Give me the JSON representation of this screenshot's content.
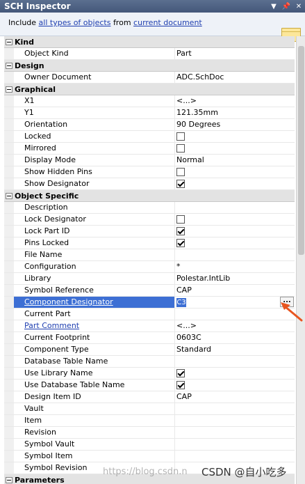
{
  "title": "SCH Inspector",
  "filter": {
    "prefix": "Include",
    "link1": "all types of objects",
    "middle": "from",
    "link2": "current document"
  },
  "categories": {
    "kind": "Kind",
    "design": "Design",
    "graphical": "Graphical",
    "object_specific": "Object Specific",
    "parameters": "Parameters"
  },
  "kind": {
    "object_kind": {
      "name": "Object Kind",
      "value": "Part"
    }
  },
  "design": {
    "owner_document": {
      "name": "Owner Document",
      "value": "ADC.SchDoc"
    }
  },
  "graphical": {
    "x1": {
      "name": "X1",
      "value": "<...>"
    },
    "y1": {
      "name": "Y1",
      "value": "121.35mm"
    },
    "orientation": {
      "name": "Orientation",
      "value": "90 Degrees"
    },
    "locked": {
      "name": "Locked",
      "checked": false
    },
    "mirrored": {
      "name": "Mirrored",
      "checked": false
    },
    "display_mode": {
      "name": "Display Mode",
      "value": "Normal"
    },
    "show_hidden_pins": {
      "name": "Show Hidden Pins",
      "checked": false
    },
    "show_designator": {
      "name": "Show Designator",
      "checked": true
    }
  },
  "object_specific": {
    "description": {
      "name": "Description",
      "value": ""
    },
    "lock_designator": {
      "name": "Lock Designator",
      "checked": false
    },
    "lock_part_id": {
      "name": "Lock Part ID",
      "checked": true
    },
    "pins_locked": {
      "name": "Pins Locked",
      "checked": true
    },
    "file_name": {
      "name": "File Name",
      "value": ""
    },
    "configuration": {
      "name": "Configuration",
      "value": "*"
    },
    "library": {
      "name": "Library",
      "value": "Polestar.IntLib"
    },
    "symbol_reference": {
      "name": "Symbol Reference",
      "value": "CAP"
    },
    "component_designator": {
      "name": "Component Designator",
      "value": "C3",
      "button": "..."
    },
    "current_part": {
      "name": "Current Part",
      "value": ""
    },
    "part_comment": {
      "name": "Part Comment",
      "value": "<...>"
    },
    "current_footprint": {
      "name": "Current Footprint",
      "value": "0603C"
    },
    "component_type": {
      "name": "Component Type",
      "value": "Standard"
    },
    "database_table_name": {
      "name": "Database Table Name",
      "value": ""
    },
    "use_library_name": {
      "name": "Use Library Name",
      "checked": true
    },
    "use_database_table_name": {
      "name": "Use Database Table Name",
      "checked": true
    },
    "design_item_id": {
      "name": "Design Item ID",
      "value": "CAP"
    },
    "vault": {
      "name": "Vault",
      "value": ""
    },
    "item": {
      "name": "Item",
      "value": ""
    },
    "revision": {
      "name": "Revision",
      "value": ""
    },
    "symbol_vault": {
      "name": "Symbol Vault",
      "value": ""
    },
    "symbol_item": {
      "name": "Symbol Item",
      "value": ""
    },
    "symbol_revision": {
      "name": "Symbol Revision",
      "value": ""
    }
  },
  "watermark": "https://blog.csdn.n",
  "watermark_strong": "CSDN @自小吃多",
  "colors": {
    "titlebar": "#4e6285",
    "selection": "#3d6fd4",
    "link": "#1f3fb0",
    "annotation_arrow": "#e8551f"
  },
  "icons": {
    "titlebar_dropdown": "triangle-down-icon",
    "titlebar_pin": "pin-icon",
    "titlebar_close": "close-icon",
    "note": "sticky-note-icon"
  }
}
